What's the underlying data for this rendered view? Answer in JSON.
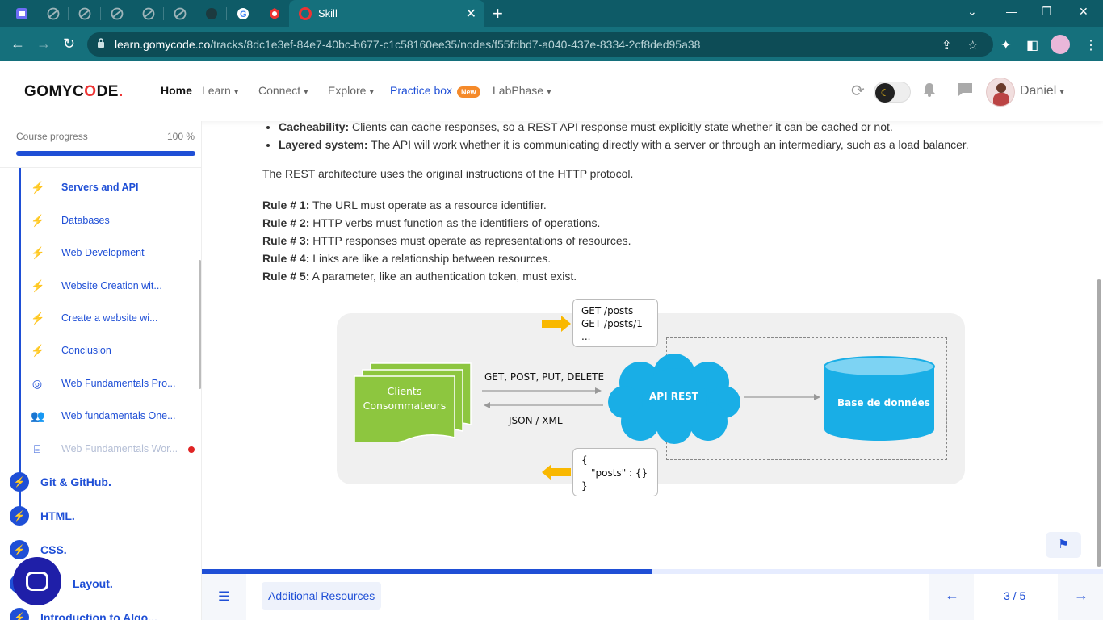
{
  "browser": {
    "tab_title": "Skill",
    "url_host": "learn.gomycode.co",
    "url_path": "/tracks/8dc1e3ef-84e7-40bc-b677-c1c58160ee35/nodes/f55fdbd7-a040-437e-8334-2cf8ded95a38"
  },
  "header": {
    "logo_left": "GOMYC",
    "logo_o": "O",
    "logo_right": "DE",
    "logo_dot": ".",
    "nav": {
      "home": "Home",
      "learn": "Learn",
      "connect": "Connect",
      "explore": "Explore",
      "practice": "Practice box",
      "practice_badge": "New",
      "labphase": "LabPhase"
    },
    "user_name": "Daniel"
  },
  "sidebar": {
    "progress_label": "Course progress",
    "progress_value": "100 %",
    "progress_fraction": 1.0,
    "sub_items": [
      {
        "label": "Servers and API",
        "icon": "bolt-icon"
      },
      {
        "label": "Databases",
        "icon": "bolt-icon"
      },
      {
        "label": "Web Development",
        "icon": "bolt-icon"
      },
      {
        "label": "Website Creation wit...",
        "icon": "bolt-icon"
      },
      {
        "label": "Create a website wi...",
        "icon": "bolt-icon"
      },
      {
        "label": "Conclusion",
        "icon": "bolt-icon"
      },
      {
        "label": "Web Fundamentals Pro...",
        "icon": "target-icon"
      },
      {
        "label": "Web fundamentals One...",
        "icon": "people-icon"
      },
      {
        "label": "Web Fundamentals Wor...",
        "icon": "workshop-icon"
      }
    ],
    "main_items": [
      {
        "label": "Git & GitHub."
      },
      {
        "label": "HTML."
      },
      {
        "label": "CSS."
      },
      {
        "label": "Layout."
      },
      {
        "label": "Introduction to Algo..."
      }
    ]
  },
  "content": {
    "bullets": [
      {
        "bold": "Cacheability:",
        "text": " Clients can cache responses, so a REST API response must explicitly state whether it can be cached or not."
      },
      {
        "bold": "Layered system:",
        "text": " The API will work whether it is communicating directly with a server or through an intermediary, such as a load balancer."
      }
    ],
    "paragraph": "The REST architecture uses the original instructions of the HTTP protocol.",
    "rules": [
      {
        "bold": "Rule # 1:",
        "text": " The URL must operate as a resource identifier."
      },
      {
        "bold": "Rule # 2:",
        "text": " HTTP verbs must function as the identifiers of operations."
      },
      {
        "bold": "Rule # 3:",
        "text": " HTTP responses must operate as representations of resources."
      },
      {
        "bold": "Rule # 4:",
        "text": " Links are like a relationship between resources."
      },
      {
        "bold": "Rule # 5:",
        "text": " A parameter, like an authentication token, must exist."
      }
    ],
    "diagram": {
      "request_line1": "GET /posts",
      "request_line2": "GET /posts/1",
      "request_line3": "...",
      "clients_line1": "Clients",
      "clients_line2": "Consommateurs",
      "verbs": "GET, POST, PUT, DELETE",
      "formats": "JSON / XML",
      "api": "API REST",
      "database": "Base de données",
      "response_line1": "{",
      "response_line2": "\"posts\"  : {}",
      "response_line3": "}"
    }
  },
  "footer": {
    "resources_button": "Additional Resources",
    "pager": "3 / 5",
    "progress_fraction": 0.5
  },
  "colors": {
    "accent": "#1f4fd6",
    "browser_frame": "#15707c",
    "diagram_green": "#8dc63f",
    "diagram_blue": "#19aee6",
    "diagram_arrow": "#f9b800"
  }
}
